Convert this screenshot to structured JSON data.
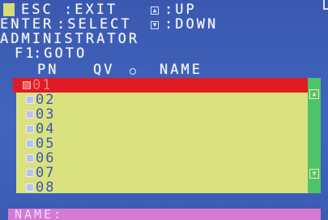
{
  "header": {
    "esc_key": "ESC",
    "esc_action": ":EXIT",
    "enter_key": "ENTER",
    "enter_action": ":SELECT",
    "up_action": ":UP",
    "down_action": ":DOWN",
    "user": "ADMINISTRATOR",
    "f1_key": "F1",
    "f1_action": ":GOTO"
  },
  "columns": {
    "pn": "PN",
    "qv": "QV",
    "name": "NAME"
  },
  "rows": [
    {
      "pn": "01",
      "selected": true
    },
    {
      "pn": "02",
      "selected": false
    },
    {
      "pn": "03",
      "selected": false
    },
    {
      "pn": "04",
      "selected": false
    },
    {
      "pn": "05",
      "selected": false
    },
    {
      "pn": "06",
      "selected": false
    },
    {
      "pn": "07",
      "selected": false
    },
    {
      "pn": "08",
      "selected": false
    }
  ],
  "footer": {
    "name_label": "NAME:",
    "name_value": ""
  },
  "icons": {
    "up_icon": "arrow-up-box",
    "down_icon": "arrow-down-box",
    "qv_icon": "sun-icon",
    "scroll_up": "scroll-up-icon",
    "scroll_down": "scroll-down-icon"
  },
  "colors": {
    "background": "#3d5db4",
    "list_background": "#d9e27f",
    "selected_row": "#e01b23",
    "scrollbar": "#4ec46a",
    "name_bar": "#d57ad3"
  }
}
